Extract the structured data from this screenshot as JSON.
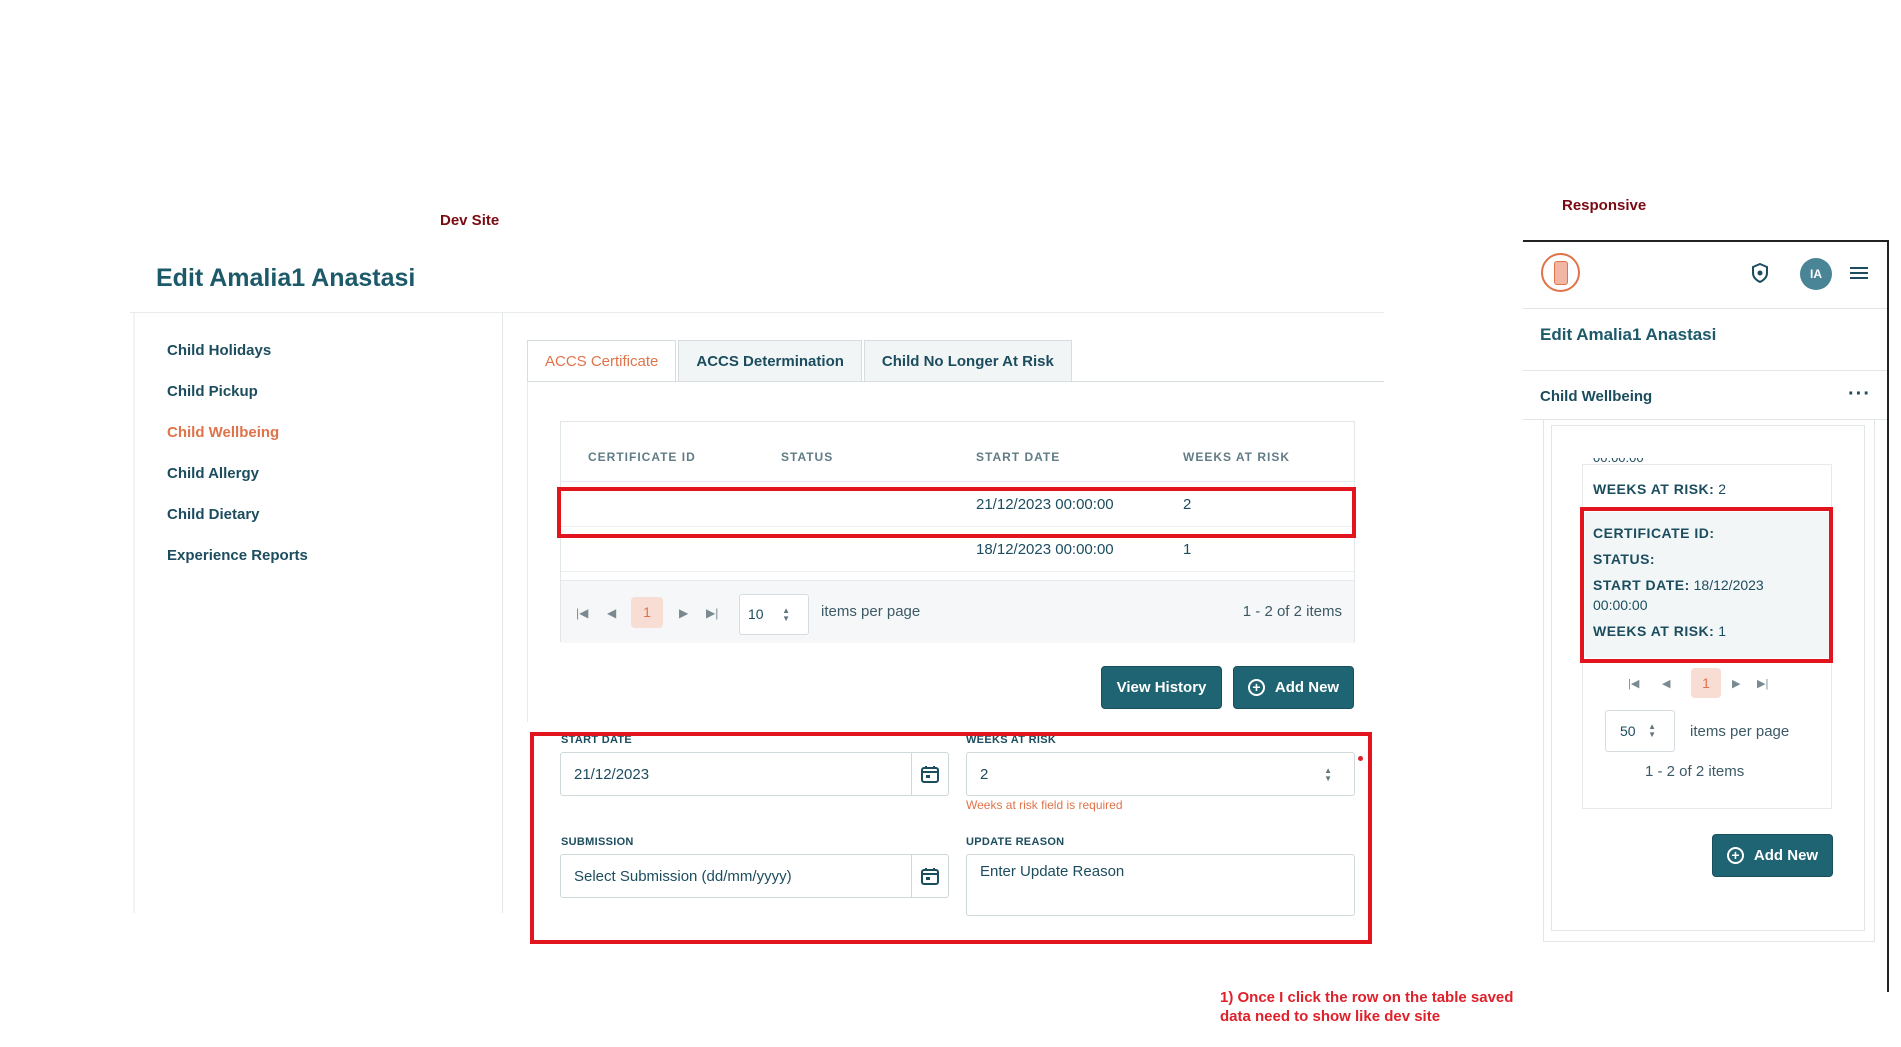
{
  "annotations": {
    "dev_site": "Dev Site",
    "responsive": "Responsive",
    "note": "1) Once I click the row on the table saved data need to show like dev site"
  },
  "dev": {
    "page_title": "Edit Amalia1 Anastasi",
    "sidebar": [
      {
        "label": "Child Holidays",
        "active": false
      },
      {
        "label": "Child Pickup",
        "active": false
      },
      {
        "label": "Child Wellbeing",
        "active": true
      },
      {
        "label": "Child Allergy",
        "active": false
      },
      {
        "label": "Child Dietary",
        "active": false
      },
      {
        "label": "Experience Reports",
        "active": false
      }
    ],
    "tabs": [
      {
        "label": "ACCS Certificate",
        "active": true
      },
      {
        "label": "ACCS Determination",
        "active": false
      },
      {
        "label": "Child No Longer At Risk",
        "active": false
      }
    ],
    "table": {
      "columns": [
        "CERTIFICATE ID",
        "STATUS",
        "START DATE",
        "WEEKS AT RISK"
      ],
      "rows": [
        {
          "certificate_id": "",
          "status": "",
          "start_date": "21/12/2023 00:00:00",
          "weeks_at_risk": "2"
        },
        {
          "certificate_id": "",
          "status": "",
          "start_date": "18/12/2023 00:00:00",
          "weeks_at_risk": "1"
        }
      ],
      "pager": {
        "page": "1",
        "page_size": "10",
        "items_per_page_label": "items per page",
        "summary": "1 - 2 of 2 items"
      }
    },
    "buttons": {
      "view_history": "View History",
      "add_new": "Add New"
    },
    "form": {
      "start_date_label": "START DATE",
      "start_date_value": "21/12/2023",
      "weeks_label": "WEEKS AT RISK",
      "weeks_value": "2",
      "weeks_error": "Weeks at risk field is required",
      "submission_label": "SUBMISSION",
      "submission_placeholder": "Select Submission (dd/mm/yyyy)",
      "reason_label": "UPDATE REASON",
      "reason_placeholder": "Enter Update Reason"
    }
  },
  "responsive": {
    "avatar_initials": "IA",
    "page_title": "Edit Amalia1 Anastasi",
    "section": "Child Wellbeing",
    "card": {
      "truncated_text": "00:00:00",
      "weeks_prev_label": "WEEKS AT RISK:",
      "weeks_prev_value": "2",
      "cert_label": "CERTIFICATE ID:",
      "status_label": "STATUS:",
      "start_label": "START DATE:",
      "start_value": "18/12/2023",
      "start_value_2": "00:00:00",
      "weeks_label": "WEEKS AT RISK:",
      "weeks_value": "1"
    },
    "pager": {
      "page": "1",
      "page_size": "50",
      "items_per_page_label": "items per page",
      "summary": "1 - 2 of 2 items"
    },
    "add_new": "Add New"
  },
  "colors": {
    "accent": "#e0734a",
    "primary": "#1f6472",
    "highlight": "#e2141d",
    "annotation": "#7a0a12"
  }
}
